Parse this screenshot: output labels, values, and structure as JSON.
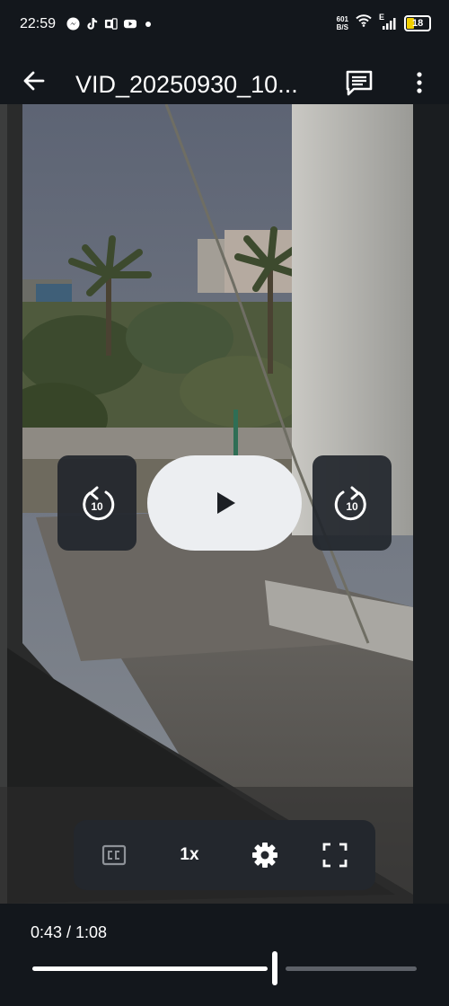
{
  "status_bar": {
    "time": "22:59",
    "net_speed_value": "601",
    "net_speed_unit": "B/S",
    "signal_type": "E",
    "battery": "18",
    "app_icons": [
      "messenger-icon",
      "tiktok-icon",
      "office-icon",
      "youtube-icon"
    ]
  },
  "app_bar": {
    "title": "VID_20250930_10..."
  },
  "player": {
    "rewind_seconds": "10",
    "forward_seconds": "10",
    "speed_label": "1x",
    "time_display": "0:43 / 1:08",
    "progress_fraction": 0.632
  },
  "colors": {
    "background": "#13171c",
    "controls": "#23272d",
    "play_button": "#eceef1",
    "battery_fill": "#f2d000",
    "seek_track": "#5d6168"
  }
}
